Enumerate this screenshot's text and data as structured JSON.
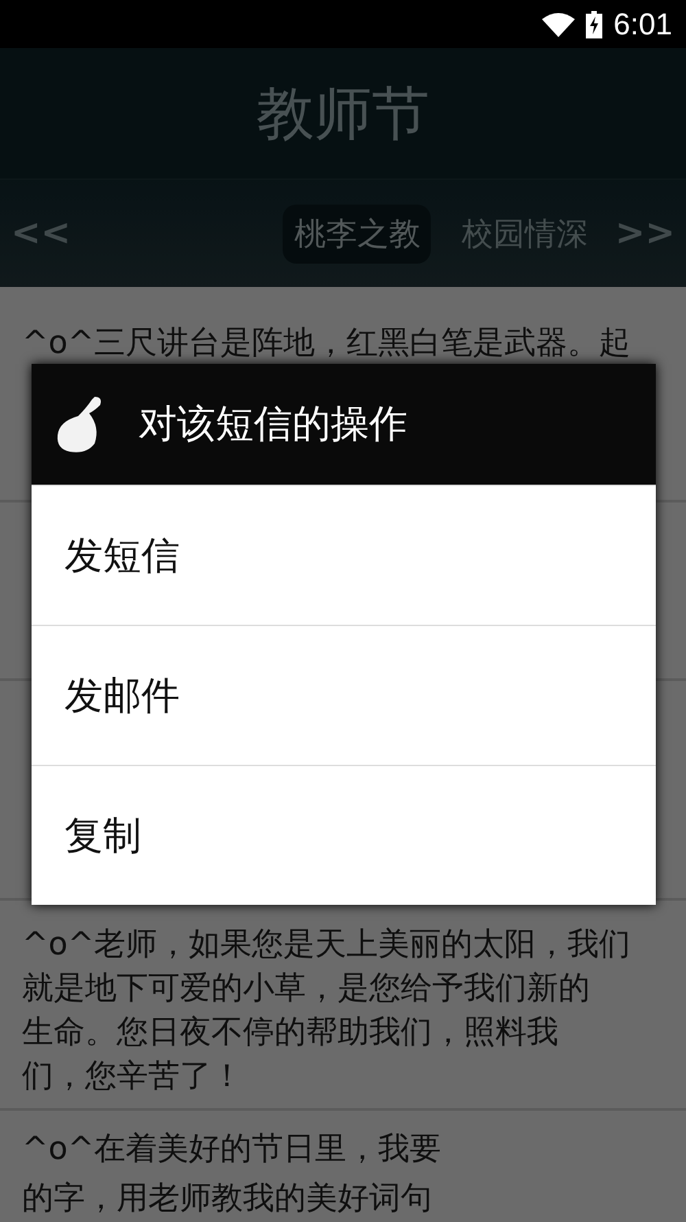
{
  "status_bar": {
    "time": "6:01"
  },
  "header": {
    "title": "教师节"
  },
  "tab_bar": {
    "prev": "<<",
    "next": ">>",
    "tabs": [
      {
        "label": "桃李之教",
        "selected": true
      },
      {
        "label": "校园情深",
        "selected": false
      }
    ]
  },
  "messages": [
    {
      "kind": "text",
      "lines": [
        "^o^三尺讲台是阵地，红黑白笔是武器。起"
      ]
    },
    {
      "kind": "covered"
    },
    {
      "kind": "covered"
    },
    {
      "kind": "text",
      "lines": [
        "^o^老师，如果您是天上美丽的太阳，我们",
        "就是地下可爱的小草，是您给予我们新的",
        "生命。您日夜不停的帮助我们，照料我",
        "们，您辛苦了！"
      ]
    },
    {
      "kind": "text",
      "lines": [
        "^o^在着美好的节日里，我要",
        "的字，用老师教我的美好词句"
      ]
    }
  ],
  "dialog": {
    "title": "对该短信的操作",
    "options": [
      "发短信",
      "发邮件",
      "复制"
    ]
  }
}
